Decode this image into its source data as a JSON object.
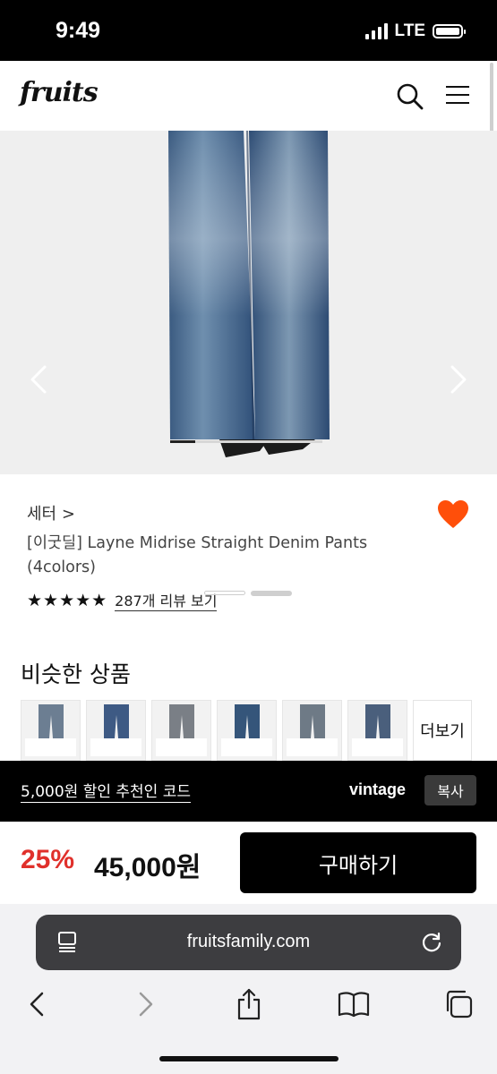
{
  "status_bar": {
    "time": "9:49",
    "network": "LTE"
  },
  "header": {
    "logo": "fruits"
  },
  "product": {
    "brand": "세터",
    "brand_chevron": ">",
    "title_line1": "[이굿딜] Layne Midrise Straight Denim Pants",
    "title_line2": "(4colors)",
    "stars": "★★★★★",
    "rating": 5,
    "review_link": "287개 리뷰 보기"
  },
  "similar": {
    "title": "비슷한 상품",
    "more_label": "더보기",
    "items_count": 6
  },
  "referral": {
    "text": "5,000원 할인 추천인 코드",
    "code": "vintage",
    "copy_label": "복사"
  },
  "purchase": {
    "discount": "25%",
    "price": "45,000원",
    "buy_label": "구매하기"
  },
  "browser": {
    "url": "fruitsfamily.com"
  },
  "colors": {
    "accent_red": "#e0302b",
    "heart_orange": "#ff4f0a",
    "black": "#000000"
  }
}
